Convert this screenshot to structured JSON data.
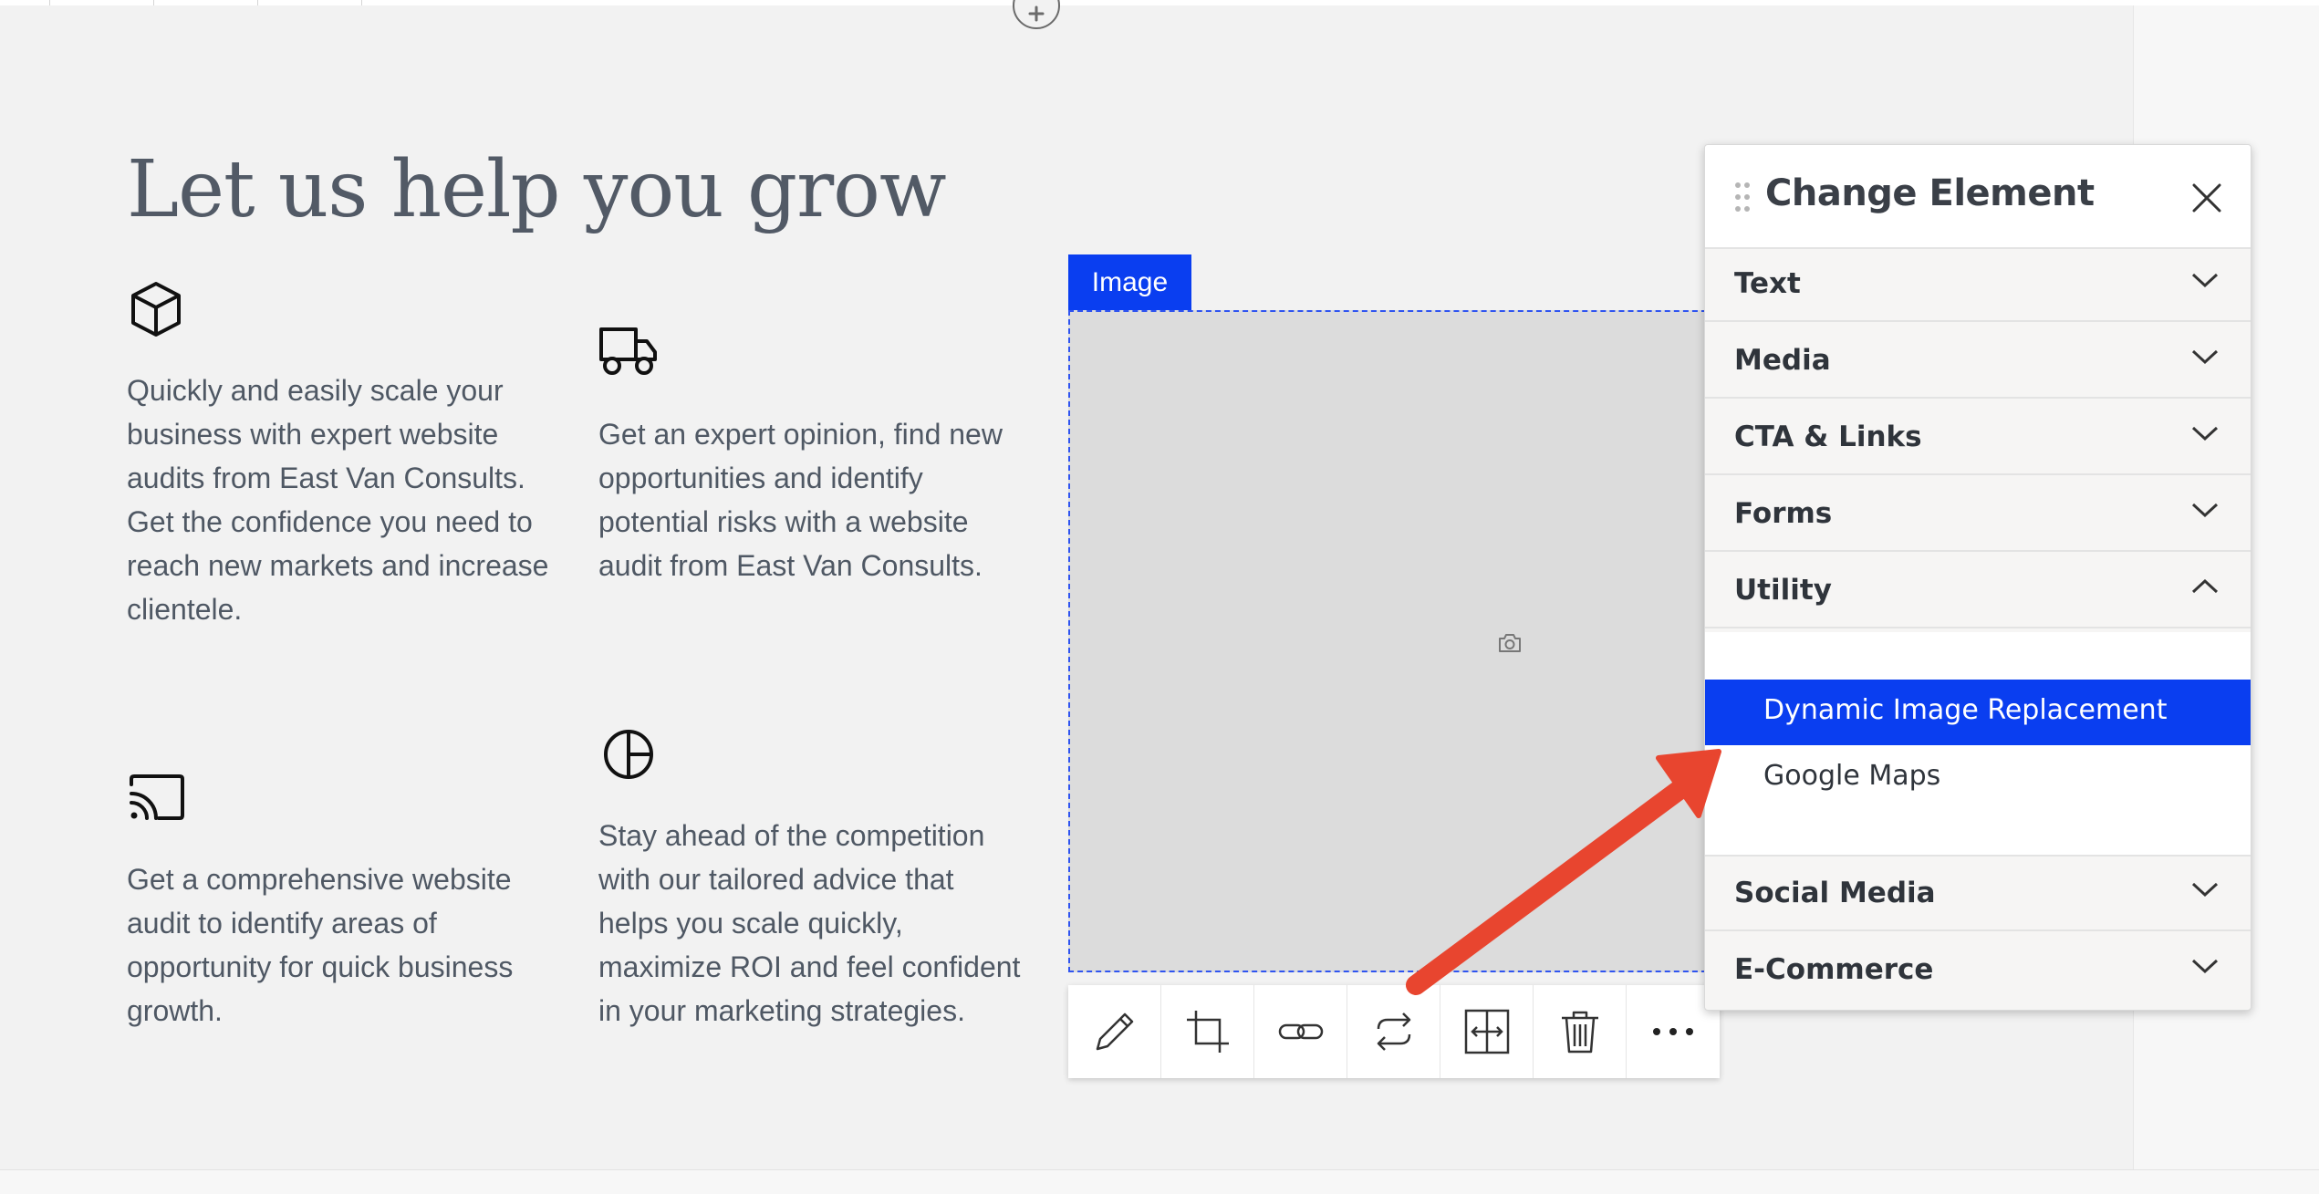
{
  "page": {
    "heading": "Let us help you grow",
    "features": [
      {
        "icon": "cube-icon",
        "text": "Quickly and easily scale your business with expert website audits from East Van Consults. Get the confidence you need to reach new markets and increase clientele."
      },
      {
        "icon": "truck-icon",
        "text": "Get an expert opinion, find new opportunities and identify potential risks with a website audit from East Van Consults."
      },
      {
        "icon": "cast-icon",
        "text": "Get a comprehensive website audit to identify areas of opportunity for quick business growth."
      },
      {
        "icon": "pie-chart-icon",
        "text": "Stay ahead of the competition with our tailored advice that helps you scale quickly, maximize ROI and feel confident in your marketing strategies."
      }
    ]
  },
  "image_element": {
    "tag_label": "Image",
    "placeholder_icon": "camera-icon",
    "toolbar": [
      "pencil-icon",
      "crop-icon",
      "link-icon",
      "swap-icon",
      "resize-icon",
      "trash-icon",
      "more-icon"
    ]
  },
  "panel": {
    "title": "Change Element",
    "sections": [
      {
        "label": "Text",
        "expanded": false
      },
      {
        "label": "Media",
        "expanded": false
      },
      {
        "label": "CTA & Links",
        "expanded": false
      },
      {
        "label": "Forms",
        "expanded": false
      },
      {
        "label": "Utility",
        "expanded": true
      },
      {
        "label": "Social Media",
        "expanded": false
      },
      {
        "label": "E-Commerce",
        "expanded": false
      }
    ],
    "utility_items": [
      {
        "label": "Dynamic Image Replacement",
        "selected": true
      },
      {
        "label": "Google Maps",
        "selected": false
      }
    ]
  },
  "colors": {
    "accent": "#0a3ef0",
    "annotation_arrow": "#e8452f",
    "page_background": "#f2f2f2",
    "body_text": "#4f5864"
  }
}
